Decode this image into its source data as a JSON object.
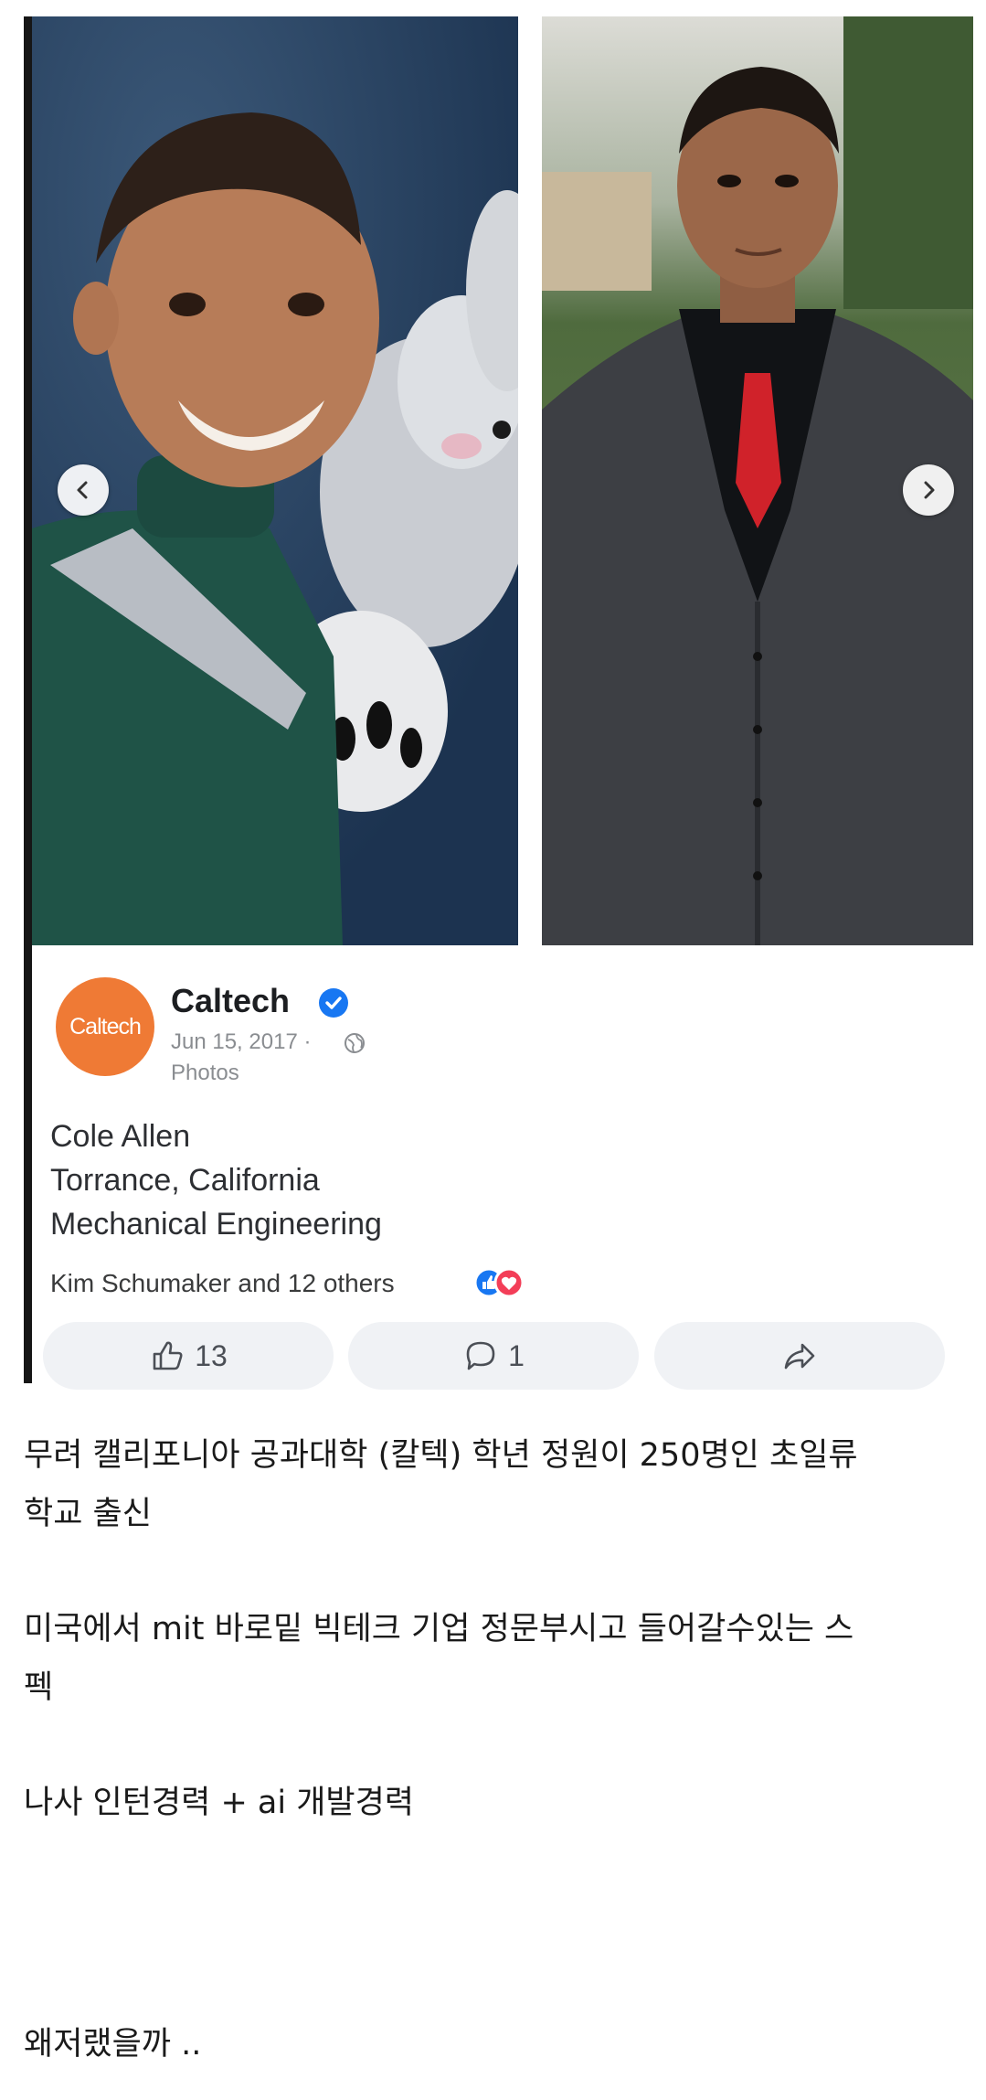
{
  "post_card": {
    "page_name": "Caltech",
    "avatar_text": "Caltech",
    "date": "Jun 15, 2017 ·",
    "album": "Photos",
    "caption_lines": [
      "Cole Allen",
      "Torrance, California",
      "Mechanical Engineering"
    ],
    "reactions_text": "Kim Schumaker and 12 others",
    "like_count": "13",
    "comment_count": "1",
    "icons": {
      "prev": "chevron-left-icon",
      "next": "chevron-right-icon",
      "verified": "verified-badge-icon",
      "privacy": "globe-icon",
      "like": "thumbs-up-icon",
      "comment": "comment-icon",
      "share": "share-arrow-icon"
    },
    "colors": {
      "avatar": "#ef7a35",
      "verified": "#1877f2",
      "like_reaction": "#1877f2",
      "love_reaction": "#f33e58",
      "pill_background": "#f0f2f5"
    }
  },
  "body": {
    "lines": [
      "무려 캘리포니아 공과대학 (칼텍) 학년 정원이 250명인 초일류",
      "학교 출신",
      "미국에서 mit 바로밑 빅테크 기업 정문부시고 들어갈수있는 스",
      "펙",
      "나사 인턴경력 + ai 개발경력",
      "왜저랬을까 .."
    ]
  }
}
